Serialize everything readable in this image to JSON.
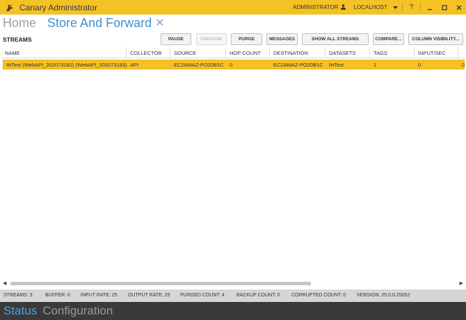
{
  "window": {
    "title": "Canary Administrator",
    "user": "ADMINISTRATOR",
    "host": "LOCALHOST",
    "help": "?",
    "accent": "#f5c225"
  },
  "header": {
    "home_tab": "Home",
    "active_tab": "Store And Forward"
  },
  "toolbar": {
    "section_label": "STREAMS",
    "pause": "PAUSE",
    "unpause": "UNPAUSE",
    "purge": "PURGE",
    "messages": "MESSAGES",
    "show_all": "SHOW ALL STREAMS",
    "compare": "COMPARE...",
    "column_visibility": "COLUMN VISIBILITY..."
  },
  "table": {
    "columns": [
      "NAME",
      "COLLECTOR",
      "SOURCE",
      "HOP COUNT",
      "DESTINATION",
      "DATASETS",
      "TAGS",
      "INPUT/SEC"
    ],
    "rows": [
      {
        "name": "IHTest (WebAPI_202073182) (WebAPI_202073183)",
        "collector": "API",
        "source": "EC2AMAZ-PO20B1C",
        "hop_count": "0",
        "destination": "EC2AMAZ-PO20B1C",
        "datasets": "IHTest",
        "tags": "1",
        "input_sec": "0",
        "overflow": "0"
      }
    ]
  },
  "status": {
    "streams": "STREAMS: 3",
    "buffer": "BUFFER: 0",
    "input_rate": "INPUT RATE: 25",
    "output_rate": "OUTPUT RATE: 25",
    "purged_count": "PURGED COUNT: 4",
    "backup_count": "BACKUP COUNT: 0",
    "corrupted_count": "CORRUPTED COUNT: 0",
    "version": "VERSION: 25.0.0.25052"
  },
  "bottom_nav": {
    "status": "Status",
    "configuration": "Configuration"
  }
}
